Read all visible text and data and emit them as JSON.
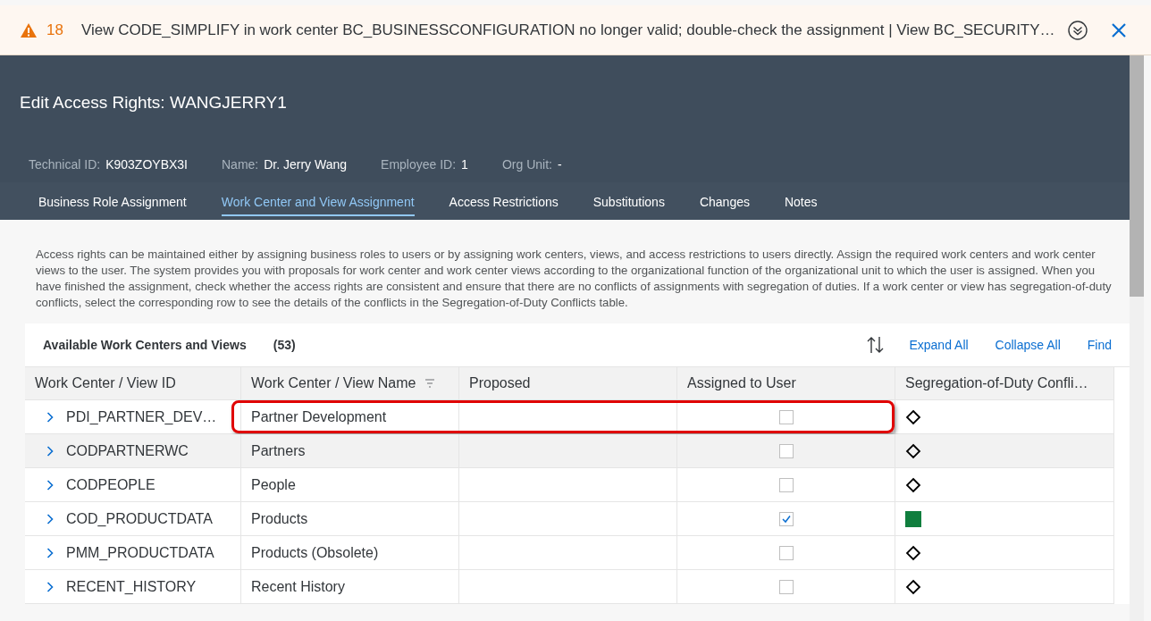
{
  "message_bar": {
    "count": "18",
    "text": "View CODE_SIMPLIFY in work center BC_BUSINESSCONFIGURATION no longer valid; double-check the assignment | View BC_SECURITY…"
  },
  "header": {
    "title": "Edit Access Rights: WANGJERRY1",
    "fields": [
      {
        "label": "Technical ID:",
        "value": "K903ZOYBX3I"
      },
      {
        "label": "Name:",
        "value": "Dr. Jerry Wang"
      },
      {
        "label": "Employee ID:",
        "value": "1"
      },
      {
        "label": "Org Unit:",
        "value": "-"
      }
    ]
  },
  "tabs": [
    {
      "label": "Business Role Assignment",
      "selected": false
    },
    {
      "label": "Work Center and View Assignment",
      "selected": true
    },
    {
      "label": "Access Restrictions",
      "selected": false
    },
    {
      "label": "Substitutions",
      "selected": false
    },
    {
      "label": "Changes",
      "selected": false
    },
    {
      "label": "Notes",
      "selected": false
    }
  ],
  "description": "Access rights can be maintained either by assigning business roles to users or by assigning work centers, views, and access restrictions to users directly. Assign the required work centers and work center views to the user. The system provides you with proposals for work center and work center views according to the organizational function of the organizational unit to which the user is assigned. When you have finished the assignment, check whether the access rights are consistent and ensure that there are no conflicts of assignments with segregation of duties. If a work center or view has segregation-of-duty conflicts, select the corresponding row to see the details of the conflicts in the Segregation-of-Duty Conflicts table.",
  "table": {
    "title": "Available Work Centers and Views",
    "count": "(53)",
    "actions": [
      "Expand All",
      "Collapse All",
      "Find"
    ],
    "columns": [
      "Work Center / View ID",
      "Work Center / View Name",
      "Proposed",
      "Assigned to User",
      "Segregation-of-Duty Confli…"
    ],
    "rows": [
      {
        "id": "PDI_PARTNER_DEV…",
        "name": "Partner Development",
        "assigned": false,
        "kind": "diamond",
        "selected": false,
        "highlighted": true
      },
      {
        "id": "CODPARTNERWC",
        "name": "Partners",
        "assigned": false,
        "kind": "diamond",
        "selected": true,
        "highlighted": false
      },
      {
        "id": "CODPEOPLE",
        "name": "People",
        "assigned": false,
        "kind": "diamond",
        "selected": false,
        "highlighted": false
      },
      {
        "id": "COD_PRODUCTDATA",
        "name": "Products",
        "assigned": true,
        "kind": "square",
        "selected": false,
        "highlighted": false
      },
      {
        "id": "PMM_PRODUCTDATA",
        "name": "Products (Obsolete)",
        "assigned": false,
        "kind": "diamond",
        "selected": false,
        "highlighted": false
      },
      {
        "id": "RECENT_HISTORY",
        "name": "Recent History",
        "assigned": false,
        "kind": "diamond",
        "selected": false,
        "highlighted": false
      }
    ]
  }
}
